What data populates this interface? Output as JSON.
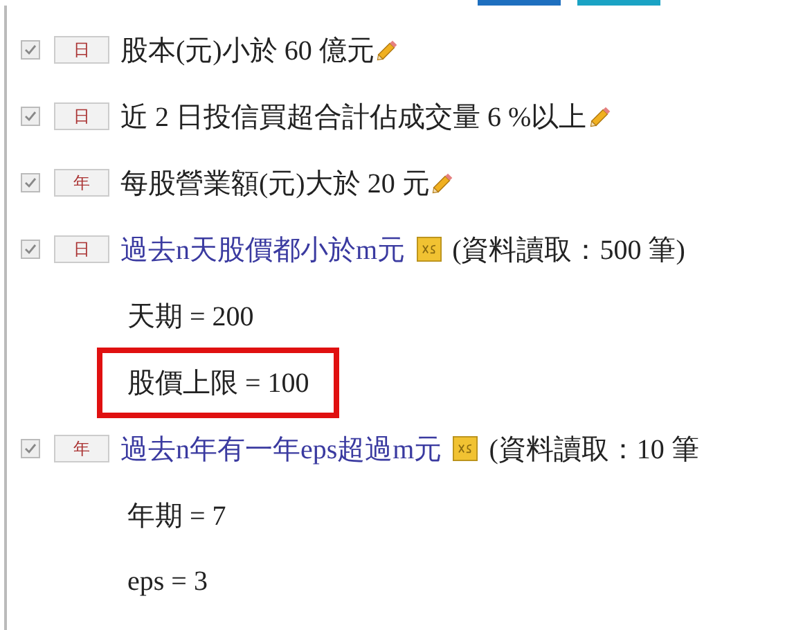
{
  "rules": [
    {
      "checked": true,
      "period": "日",
      "title": "股本(元)小於 60 億元",
      "kind": "editable"
    },
    {
      "checked": true,
      "period": "日",
      "title": "近 2 日投信買超合計佔成交量 6 %以上",
      "kind": "editable"
    },
    {
      "checked": true,
      "period": "年",
      "title": "每股營業額(元)大於 20 元",
      "kind": "editable"
    },
    {
      "checked": true,
      "period": "日",
      "title": "過去n天股價都小於m元",
      "kind": "link",
      "note": "(資料讀取：500 筆)",
      "params": [
        {
          "text": "天期 = 200",
          "highlighted": false
        },
        {
          "text": "股價上限 = 100",
          "highlighted": true
        }
      ]
    },
    {
      "checked": true,
      "period": "年",
      "title": "過去n年有一年eps超過m元",
      "kind": "link",
      "note": "(資料讀取：10 筆",
      "params": [
        {
          "text": "年期 = 7",
          "highlighted": false
        },
        {
          "text": "eps = 3",
          "highlighted": false
        }
      ]
    }
  ]
}
